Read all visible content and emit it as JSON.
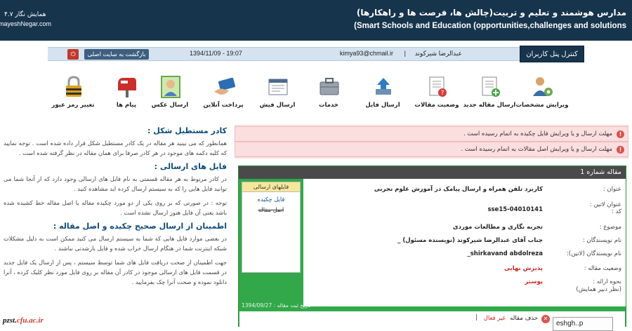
{
  "header": {
    "title_fa": "مدارس هوشمند و تعلیم و تربیت(چالش ها، فرصت ها و راهکارها)",
    "title_en": "(Smart Schools and Education (opportunities,challenges and solutions",
    "logo_fa": "همایش نگار  ۴.۷",
    "logo_en": "mayeshNegar.com"
  },
  "userbar": {
    "panel_tab": "کنترل پنل کاربران",
    "username": "عبدالرضا شیرکوند",
    "separator": "|",
    "email": "kimya93@chmail.ir",
    "datetime": "1394/11/09 - 19:07",
    "back_button": "بازگشت به سایت اصلی",
    "power_icon": "power-icon"
  },
  "toolbar": {
    "items": [
      {
        "label": "ویرایش مشخصات",
        "icon": "users-gear-icon"
      },
      {
        "label": "ارسال مقاله جدید",
        "icon": "new-article-icon"
      },
      {
        "label": "وضعیت مقالات",
        "icon": "article-status-icon"
      },
      {
        "label": "ارسال فایل",
        "icon": "upload-file-icon"
      },
      {
        "label": "خدمات",
        "icon": "services-icon"
      },
      {
        "label": "ارسال فیش",
        "icon": "receipt-icon"
      },
      {
        "label": "پرداخت آنلاین",
        "icon": "online-payment-icon"
      },
      {
        "label": "ارسال عکس",
        "icon": "photo-icon"
      },
      {
        "label": "پیام ها",
        "icon": "mailbox-icon"
      },
      {
        "label": "تغییر رمز عبور",
        "icon": "lock-icon"
      }
    ]
  },
  "help": {
    "h1": "کادر مستطیل شکل :",
    "p1": "همانطور که می بینید هر مقاله در یک کادر مستطیل شکل قرار داده شده است . توجه نمایید که کلیه دکمه های موجود در هر کادر صرفا برای همان مقاله در نظر گرفته شده است .",
    "h2": "فایل های ارسالی :",
    "p2": "در کادر مربوط به هر مقاله قسمتی به نام فایل های ارسالی وجود دارد که از آنجا شما می توانید فایل هایی را که به سیستم ارسال کرده اید مشاهده کنید .",
    "p3": "توجه : در صورتی که بر روی یکی از دو مورد چکیده مقاله یا اصل مقاله خط کشیده شده باشد یعنی آن فایل هنوز ارسال نشده است .",
    "h3": "اطمینان از ارسال صحیح چکیده و اصل مقاله :",
    "p4": "در بعضی موارد فایل هایی که شما به سیستم ارسال می کنید ممکن است به دلیل مشکلات شبکه اینترنت شما در هنگام ارسال خراب شده و فایل بازشدنی نباشند .",
    "p5": "جهت اطمینان از صحت دریافت فایل های شما توسط سیستم ، پس از ارسال یک فایل جدید در قسمت فایل های ارسالی موجود در کادر آن مقاله بر روی فایل مورد نظر کلیک کرده ، آنرا دانلود نموده و صحت آنرا چک بفرمایید ."
  },
  "alerts": [
    "مهلت ارسال و یا ویرایش فایل چکیده به اتمام رسیده است .",
    "مهلت ارسال و یا ویرایش اصل مقالات به اتمام رسیده است ."
  ],
  "article": {
    "card_title": "مقاله شماره 1",
    "fields": [
      {
        "key": "عنوان :",
        "value": "کاربرد تلفن همراه و ارسال پیامک در آموزش علوم تجربی",
        "red": false
      },
      {
        "key": "عنوان لاتین :",
        "value": "",
        "red": false
      },
      {
        "key": "کد :",
        "value": "sse15-04010141",
        "red": false
      },
      {
        "key": "موضوع :",
        "value": "تجربه نگاری و مطالعات موردی",
        "red": false
      },
      {
        "key": "نام نویسندگان :",
        "value": "جناب آقای عبدالرضا شیرکوند (نویسنده مسئول) _",
        "red": false
      },
      {
        "key": "نام نویسندگان (لاتین):",
        "value": "shirkavand abdolreza_",
        "red": false
      },
      {
        "key": "وضعیت مقاله :",
        "value": "پذیرش نهایی",
        "red": true
      },
      {
        "key": "نحوه ارائه :",
        "key2": "(نظر دبیر همایش)",
        "value": "پوستر",
        "red": true
      }
    ],
    "attachments_title": "فایلهای ارسالی",
    "attachments": [
      "فایل چکیده",
      "اصل مقاله"
    ],
    "date_line": "تاریخ ثبت مقاله : 1394/09/27",
    "delete_label": "حذف مقاله",
    "inactive_label": "غیر فعال",
    "bar": "|"
  },
  "watermark": {
    "prefix": "pzst.",
    "domain": "cfu.ac.ir"
  },
  "chip": "eshgh..p"
}
